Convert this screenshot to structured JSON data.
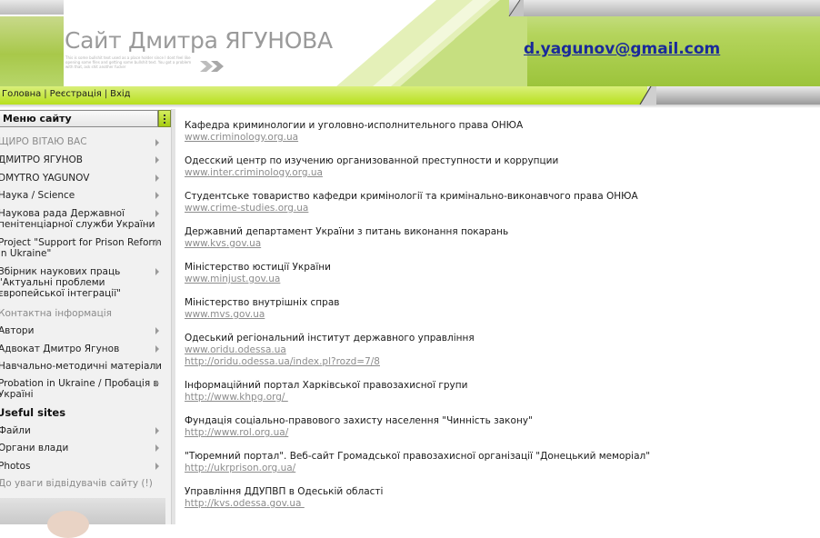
{
  "header": {
    "site_title": "Сайт Дмитра ЯГУНОВА",
    "tagline": "This is some bullshit text used as a place holder since I dont feel like opening some files and getting some bullshit text. You got a problem with that, ask shit another fucker",
    "email": "d.yagunov@gmail.com"
  },
  "nav": {
    "links": [
      "Головна",
      "Реєстрація",
      "Вхід"
    ],
    "separator": "|"
  },
  "sidebar": {
    "menu_title": "Меню сайту",
    "items": [
      {
        "label": "ЩИРО ВІТАЮ ВАС",
        "arrow": true
      },
      {
        "label": "ДМИТРО ЯГУНОВ",
        "arrow": true
      },
      {
        "label": "DMYTRO YAGUNOV",
        "arrow": true
      },
      {
        "label": "Наука / Science",
        "arrow": true
      },
      {
        "label": "Наукова рада Державної\nпенітенціарної служби України",
        "arrow": true
      },
      {
        "label": "Project \"Support for Prison Reform\nin Ukraine\"",
        "arrow": true
      },
      {
        "label": "Збірник наукових праць\n\"Актуальні проблеми\nєвропейської інтеграції\"",
        "arrow": true
      },
      {
        "label": "Контактна інформація",
        "arrow": false
      },
      {
        "label": "Автори",
        "arrow": true
      },
      {
        "label": "Адвокат Дмитро Ягунов",
        "arrow": true
      },
      {
        "label": "Навчально-методичні матеріали",
        "arrow": true
      },
      {
        "label": "Probation in Ukraine / Пробація в\nУкраїні",
        "arrow": true
      },
      {
        "label": "Useful sites",
        "arrow": false
      },
      {
        "label": "Файли",
        "arrow": true
      },
      {
        "label": "Органи влади",
        "arrow": true
      },
      {
        "label": "Photos",
        "arrow": true
      },
      {
        "label": "До уваги відвідувачів сайту (!)",
        "arrow": false
      }
    ]
  },
  "content": {
    "entries": [
      {
        "title": "Кафедра криминологии и уголовно-исполнительного права ОНЮА",
        "urls": [
          "www.criminology.org.ua"
        ]
      },
      {
        "title": "Одесский центр по изучению организованной преступности и коррупции",
        "urls": [
          "www.inter.criminology.org.ua"
        ]
      },
      {
        "title": "Студентське товариство кафедри кримінології та кримінально-виконавчого права ОНЮА",
        "urls": [
          "www.crime-studies.org.ua"
        ]
      },
      {
        "title": "Державний департамент України з питань виконання покарань",
        "urls": [
          "www.kvs.gov.ua"
        ]
      },
      {
        "title": "Міністерство юстиції України",
        "urls": [
          "www.minjust.gov.ua"
        ]
      },
      {
        "title": "Міністерство внутрішніх справ",
        "urls": [
          "www.mvs.gov.ua"
        ]
      },
      {
        "title": "Одеський регіональний інститут державного управління",
        "urls": [
          "www.oridu.odessa.ua",
          "http://oridu.odessa.ua/index.pl?rozd=7/8"
        ]
      },
      {
        "title": "Інформаційний портал Харківської правозахисної групи",
        "urls": [
          "http://www.khpg.org/ "
        ]
      },
      {
        "title": "Фундація соціально-правового захисту населення \"Чинність закону\"",
        "urls": [
          "http://www.rol.org.ua/"
        ]
      },
      {
        "title": "\"Тюремний портал\". Веб-сайт Громадської правозахисної організації \"Донецький меморіал\"",
        "urls": [
          "http://ukrprison.org.ua/"
        ]
      },
      {
        "title": "Управління ДДУПВП в Одеській області",
        "urls": [
          "http://kvs.odessa.gov.ua "
        ]
      }
    ]
  }
}
